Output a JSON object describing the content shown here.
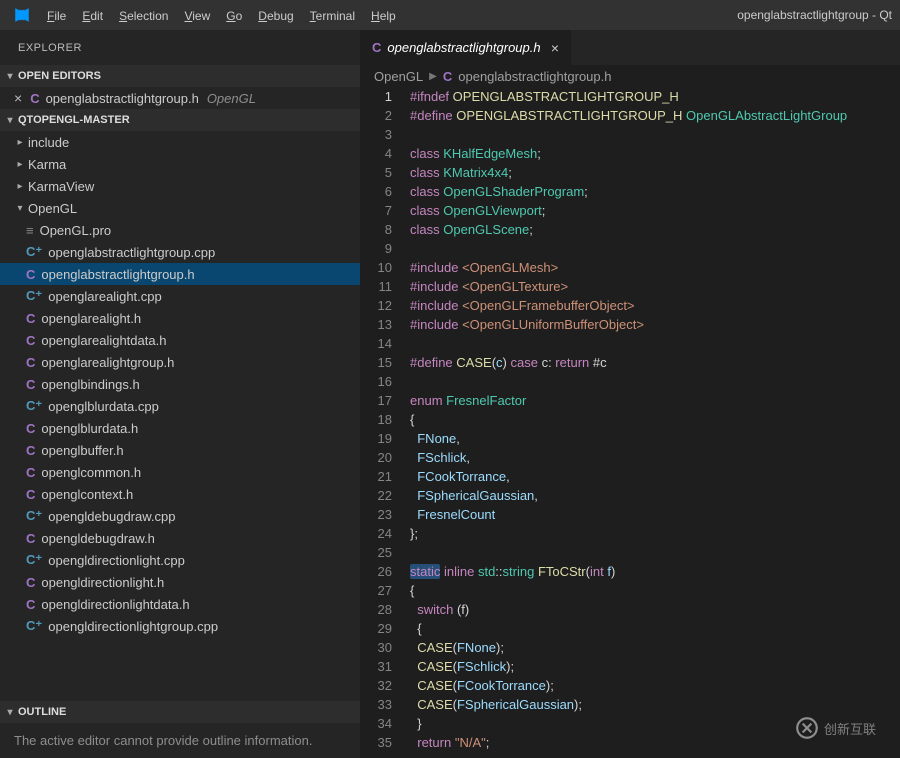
{
  "window": {
    "title_right": "openglabstractlightgroup - Qt"
  },
  "menubar": {
    "items": [
      "File",
      "Edit",
      "Selection",
      "View",
      "Go",
      "Debug",
      "Terminal",
      "Help"
    ]
  },
  "sidebar": {
    "title": "EXPLORER",
    "sections": {
      "open_editors": {
        "label": "OPEN EDITORS",
        "entries": [
          {
            "icon": "c",
            "name": "openglabstractlightgroup.h",
            "folder": "OpenGL"
          }
        ]
      },
      "project": {
        "label": "QTOPENGL-MASTER",
        "tree": [
          {
            "kind": "folder",
            "name": "include",
            "open": false,
            "depth": 0
          },
          {
            "kind": "folder",
            "name": "Karma",
            "open": false,
            "depth": 0
          },
          {
            "kind": "folder",
            "name": "KarmaView",
            "open": false,
            "depth": 0
          },
          {
            "kind": "folder",
            "name": "OpenGL",
            "open": true,
            "depth": 0
          },
          {
            "kind": "file",
            "icon": "txt",
            "name": "OpenGL.pro",
            "depth": 1
          },
          {
            "kind": "file",
            "icon": "cpp",
            "name": "openglabstractlightgroup.cpp",
            "depth": 1
          },
          {
            "kind": "file",
            "icon": "c",
            "name": "openglabstractlightgroup.h",
            "depth": 1,
            "selected": true
          },
          {
            "kind": "file",
            "icon": "cpp",
            "name": "openglarealight.cpp",
            "depth": 1
          },
          {
            "kind": "file",
            "icon": "c",
            "name": "openglarealight.h",
            "depth": 1
          },
          {
            "kind": "file",
            "icon": "c",
            "name": "openglarealightdata.h",
            "depth": 1
          },
          {
            "kind": "file",
            "icon": "c",
            "name": "openglarealightgroup.h",
            "depth": 1
          },
          {
            "kind": "file",
            "icon": "c",
            "name": "openglbindings.h",
            "depth": 1
          },
          {
            "kind": "file",
            "icon": "cpp",
            "name": "openglblurdata.cpp",
            "depth": 1
          },
          {
            "kind": "file",
            "icon": "c",
            "name": "openglblurdata.h",
            "depth": 1
          },
          {
            "kind": "file",
            "icon": "c",
            "name": "openglbuffer.h",
            "depth": 1
          },
          {
            "kind": "file",
            "icon": "c",
            "name": "openglcommon.h",
            "depth": 1
          },
          {
            "kind": "file",
            "icon": "c",
            "name": "openglcontext.h",
            "depth": 1
          },
          {
            "kind": "file",
            "icon": "cpp",
            "name": "opengldebugdraw.cpp",
            "depth": 1
          },
          {
            "kind": "file",
            "icon": "c",
            "name": "opengldebugdraw.h",
            "depth": 1
          },
          {
            "kind": "file",
            "icon": "cpp",
            "name": "opengldirectionlight.cpp",
            "depth": 1
          },
          {
            "kind": "file",
            "icon": "c",
            "name": "opengldirectionlight.h",
            "depth": 1
          },
          {
            "kind": "file",
            "icon": "c",
            "name": "opengldirectionlightdata.h",
            "depth": 1
          },
          {
            "kind": "file",
            "icon": "cpp",
            "name": "opengldirectionlightgroup.cpp",
            "depth": 1
          }
        ]
      },
      "outline": {
        "label": "OUTLINE",
        "message": "The active editor cannot provide outline information."
      }
    }
  },
  "editor": {
    "tab": {
      "name": "openglabstractlightgroup.h"
    },
    "breadcrumb": [
      "OpenGL",
      "openglabstractlightgroup.h"
    ],
    "current_line": 1,
    "lines": [
      [
        [
          "pp",
          "#ifndef"
        ],
        [
          "w",
          " "
        ],
        [
          "mac",
          "OPENGLABSTRACTLIGHTGROUP_H"
        ]
      ],
      [
        [
          "pp",
          "#define"
        ],
        [
          "w",
          " "
        ],
        [
          "mac",
          "OPENGLABSTRACTLIGHTGROUP_H"
        ],
        [
          "w",
          " "
        ],
        [
          "type",
          "OpenGLAbstractLightGroup"
        ]
      ],
      [],
      [
        [
          "kw",
          "class"
        ],
        [
          "w",
          " "
        ],
        [
          "type",
          "KHalfEdgeMesh"
        ],
        [
          "w",
          ";"
        ]
      ],
      [
        [
          "kw",
          "class"
        ],
        [
          "w",
          " "
        ],
        [
          "type",
          "KMatrix4x4"
        ],
        [
          "w",
          ";"
        ]
      ],
      [
        [
          "kw",
          "class"
        ],
        [
          "w",
          " "
        ],
        [
          "type",
          "OpenGLShaderProgram"
        ],
        [
          "w",
          ";"
        ]
      ],
      [
        [
          "kw",
          "class"
        ],
        [
          "w",
          " "
        ],
        [
          "type",
          "OpenGLViewport"
        ],
        [
          "w",
          ";"
        ]
      ],
      [
        [
          "kw",
          "class"
        ],
        [
          "w",
          " "
        ],
        [
          "type",
          "OpenGLScene"
        ],
        [
          "w",
          ";"
        ]
      ],
      [],
      [
        [
          "pp",
          "#include"
        ],
        [
          "w",
          " "
        ],
        [
          "str",
          "<OpenGLMesh>"
        ]
      ],
      [
        [
          "pp",
          "#include"
        ],
        [
          "w",
          " "
        ],
        [
          "str",
          "<OpenGLTexture>"
        ]
      ],
      [
        [
          "pp",
          "#include"
        ],
        [
          "w",
          " "
        ],
        [
          "str",
          "<OpenGLFramebufferObject>"
        ]
      ],
      [
        [
          "pp",
          "#include"
        ],
        [
          "w",
          " "
        ],
        [
          "str",
          "<OpenGLUniformBufferObject>"
        ]
      ],
      [],
      [
        [
          "pp",
          "#define"
        ],
        [
          "w",
          " "
        ],
        [
          "mac",
          "CASE"
        ],
        [
          "w",
          "("
        ],
        [
          "ent",
          "c"
        ],
        [
          "w",
          ") "
        ],
        [
          "kw",
          "case"
        ],
        [
          "w",
          " c: "
        ],
        [
          "kw",
          "return"
        ],
        [
          "w",
          " #c"
        ]
      ],
      [],
      [
        [
          "kw",
          "enum"
        ],
        [
          "w",
          " "
        ],
        [
          "type",
          "FresnelFactor"
        ]
      ],
      [
        [
          "w",
          "{"
        ]
      ],
      [
        [
          "w",
          "  "
        ],
        [
          "ent",
          "FNone"
        ],
        [
          "w",
          ","
        ]
      ],
      [
        [
          "w",
          "  "
        ],
        [
          "ent",
          "FSchlick"
        ],
        [
          "w",
          ","
        ]
      ],
      [
        [
          "w",
          "  "
        ],
        [
          "ent",
          "FCookTorrance"
        ],
        [
          "w",
          ","
        ]
      ],
      [
        [
          "w",
          "  "
        ],
        [
          "ent",
          "FSphericalGaussian"
        ],
        [
          "w",
          ","
        ]
      ],
      [
        [
          "w",
          "  "
        ],
        [
          "ent",
          "FresnelCount"
        ]
      ],
      [
        [
          "w",
          "};"
        ]
      ],
      [],
      [
        [
          "hl",
          "static"
        ],
        [
          "w",
          " "
        ],
        [
          "kw",
          "inline"
        ],
        [
          "w",
          " "
        ],
        [
          "type",
          "std"
        ],
        [
          "w",
          "::"
        ],
        [
          "type",
          "string"
        ],
        [
          "w",
          " "
        ],
        [
          "fn",
          "FToCStr"
        ],
        [
          "w",
          "("
        ],
        [
          "kw",
          "int"
        ],
        [
          "w",
          " "
        ],
        [
          "ent",
          "f"
        ],
        [
          "w",
          ")"
        ]
      ],
      [
        [
          "w",
          "{"
        ]
      ],
      [
        [
          "w",
          "  "
        ],
        [
          "kw",
          "switch"
        ],
        [
          "w",
          " (f)"
        ]
      ],
      [
        [
          "w",
          "  {"
        ]
      ],
      [
        [
          "w",
          "  "
        ],
        [
          "mac",
          "CASE"
        ],
        [
          "w",
          "("
        ],
        [
          "ent",
          "FNone"
        ],
        [
          "w",
          ");"
        ]
      ],
      [
        [
          "w",
          "  "
        ],
        [
          "mac",
          "CASE"
        ],
        [
          "w",
          "("
        ],
        [
          "ent",
          "FSchlick"
        ],
        [
          "w",
          ");"
        ]
      ],
      [
        [
          "w",
          "  "
        ],
        [
          "mac",
          "CASE"
        ],
        [
          "w",
          "("
        ],
        [
          "ent",
          "FCookTorrance"
        ],
        [
          "w",
          ");"
        ]
      ],
      [
        [
          "w",
          "  "
        ],
        [
          "mac",
          "CASE"
        ],
        [
          "w",
          "("
        ],
        [
          "ent",
          "FSphericalGaussian"
        ],
        [
          "w",
          ");"
        ]
      ],
      [
        [
          "w",
          "  }"
        ]
      ],
      [
        [
          "w",
          "  "
        ],
        [
          "kw",
          "return"
        ],
        [
          "w",
          " "
        ],
        [
          "str",
          "\"N/A\""
        ],
        [
          "w",
          ";"
        ]
      ]
    ]
  },
  "watermark": {
    "text": "创新互联"
  }
}
